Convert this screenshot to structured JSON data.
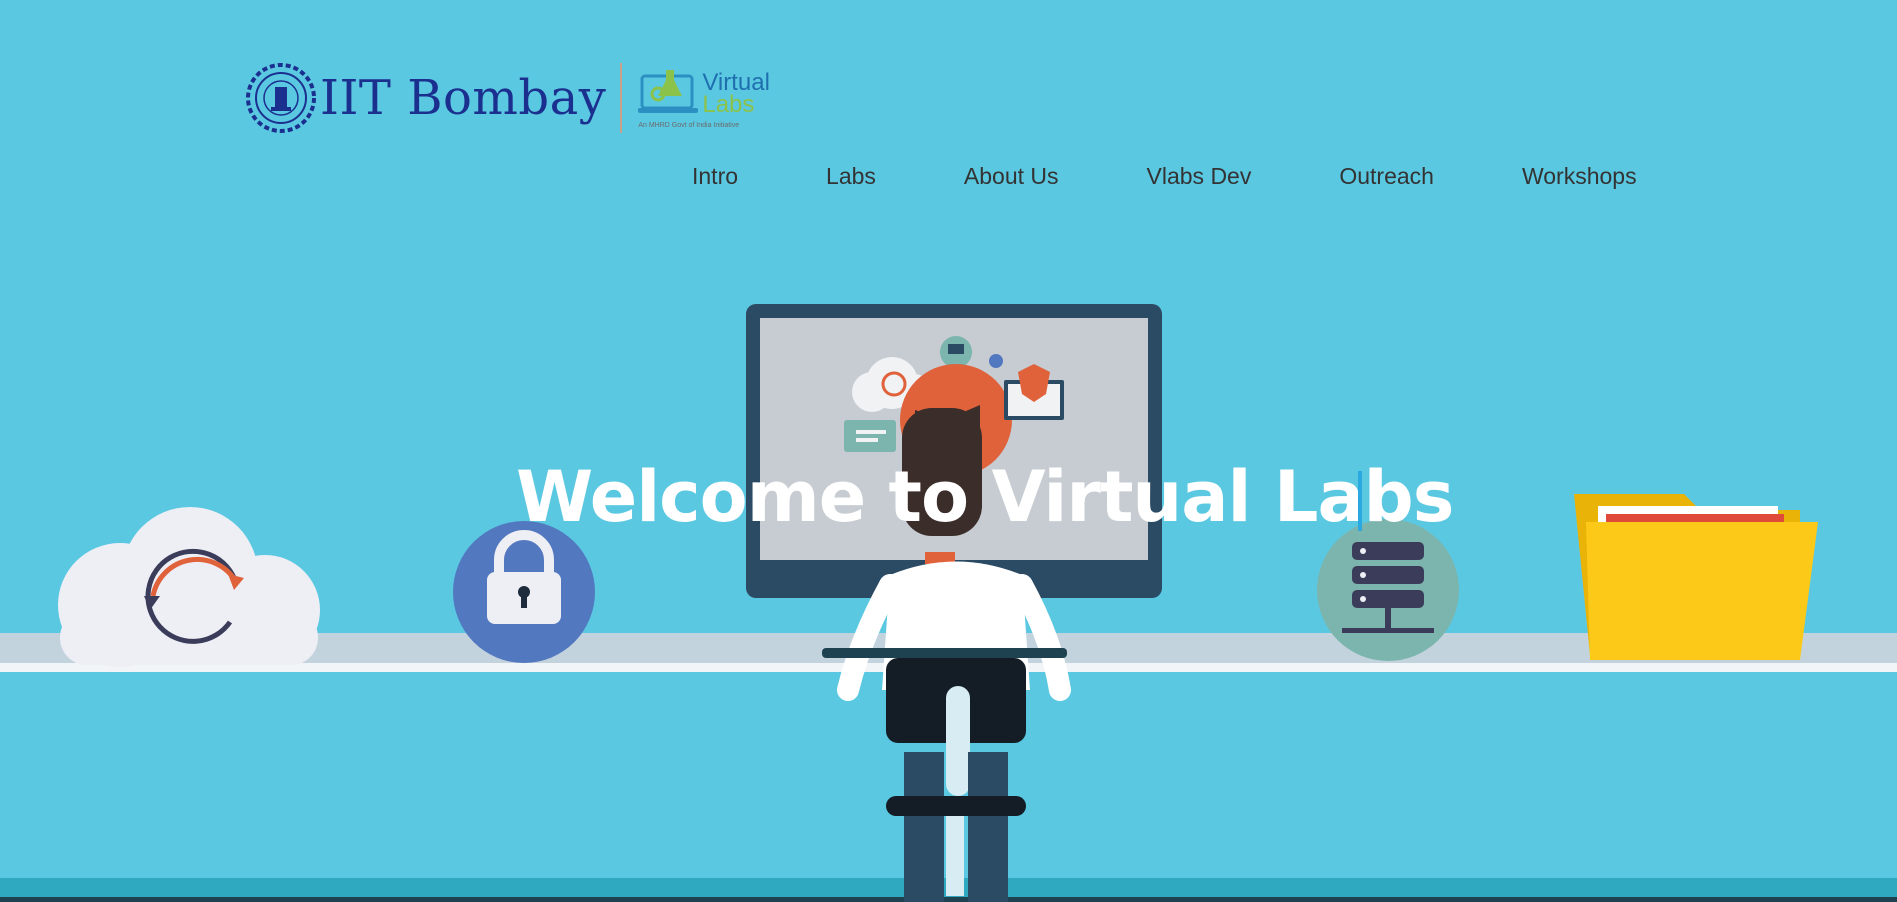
{
  "header": {
    "institute": "IIT Bombay",
    "lab_logo": {
      "word1": "Virtual",
      "word2": "Labs",
      "tagline": "An MHRD Govt of India Initiative"
    }
  },
  "nav": {
    "items": [
      {
        "label": "Intro"
      },
      {
        "label": "Labs"
      },
      {
        "label": "About Us"
      },
      {
        "label": "Vlabs Dev"
      },
      {
        "label": "Outreach"
      },
      {
        "label": "Workshops"
      }
    ]
  },
  "hero": {
    "title": "Welcome to Virtual Labs"
  },
  "colors": {
    "background": "#5bc8e2",
    "nav_text": "#333333",
    "institute_text": "#1b2f8f",
    "hero_text": "#ffffff",
    "cursor": "#2aa8e0"
  },
  "illustration": {
    "icons": [
      "sync-cloud-icon",
      "padlock-icon",
      "computer-monitor",
      "person-at-desk",
      "server-icon",
      "folder-icon"
    ]
  }
}
